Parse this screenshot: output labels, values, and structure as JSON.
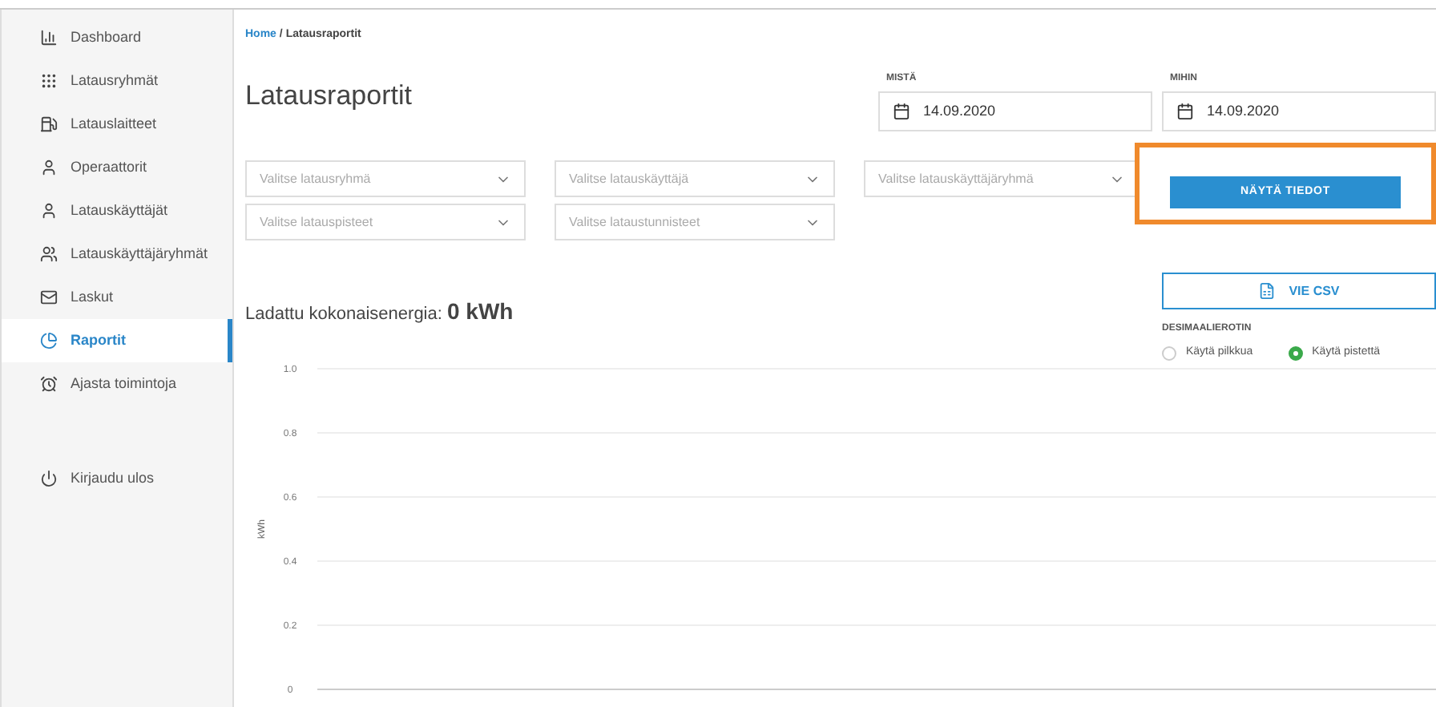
{
  "sidebar": {
    "items": [
      {
        "label": "Dashboard",
        "selected": false
      },
      {
        "label": "Latausryhmät",
        "selected": false
      },
      {
        "label": "Latauslaitteet",
        "selected": false
      },
      {
        "label": "Operaattorit",
        "selected": false
      },
      {
        "label": "Latauskäyttäjät",
        "selected": false
      },
      {
        "label": "Latauskäyttäjäryhmät",
        "selected": false
      },
      {
        "label": "Laskut",
        "selected": false
      },
      {
        "label": "Raportit",
        "selected": true
      },
      {
        "label": "Ajasta toimintoja",
        "selected": false
      }
    ],
    "logout": "Kirjaudu ulos"
  },
  "breadcrumb": {
    "home": "Home",
    "separator": "/",
    "current": "Latausraportit"
  },
  "title": "Latausraportit",
  "dates": [
    {
      "label": "MISTÄ",
      "value": "14.09.2020"
    },
    {
      "label": "MIHIN",
      "value": "14.09.2020"
    }
  ],
  "filters": [
    {
      "placeholder": "Valitse latausryhmä"
    },
    {
      "placeholder": "Valitse latauskäyttäjä"
    },
    {
      "placeholder": "Valitse latauskäyttäjäryhmä"
    },
    {
      "placeholder": "Valitse latauspisteet"
    },
    {
      "placeholder": "Valitse lataustunnisteet"
    }
  ],
  "show_button": {
    "label": "NÄYTÄ TIEDOT",
    "highlighted": true
  },
  "energy": {
    "label": "Ladattu kokonaisenergia:",
    "value": "0 kWh"
  },
  "export_button": "VIE CSV",
  "decimal": {
    "label": "DESIMAALIEROTIN",
    "options": [
      {
        "label": "Käytä pilkkua",
        "selected": false
      },
      {
        "label": "Käytä pistettä",
        "selected": true
      }
    ]
  },
  "empty_chart": {
    "axis_title": "kWh",
    "tick_labels": [
      "1.0",
      "0.8",
      "0.6",
      "0.4",
      "0.2",
      "0"
    ]
  }
}
